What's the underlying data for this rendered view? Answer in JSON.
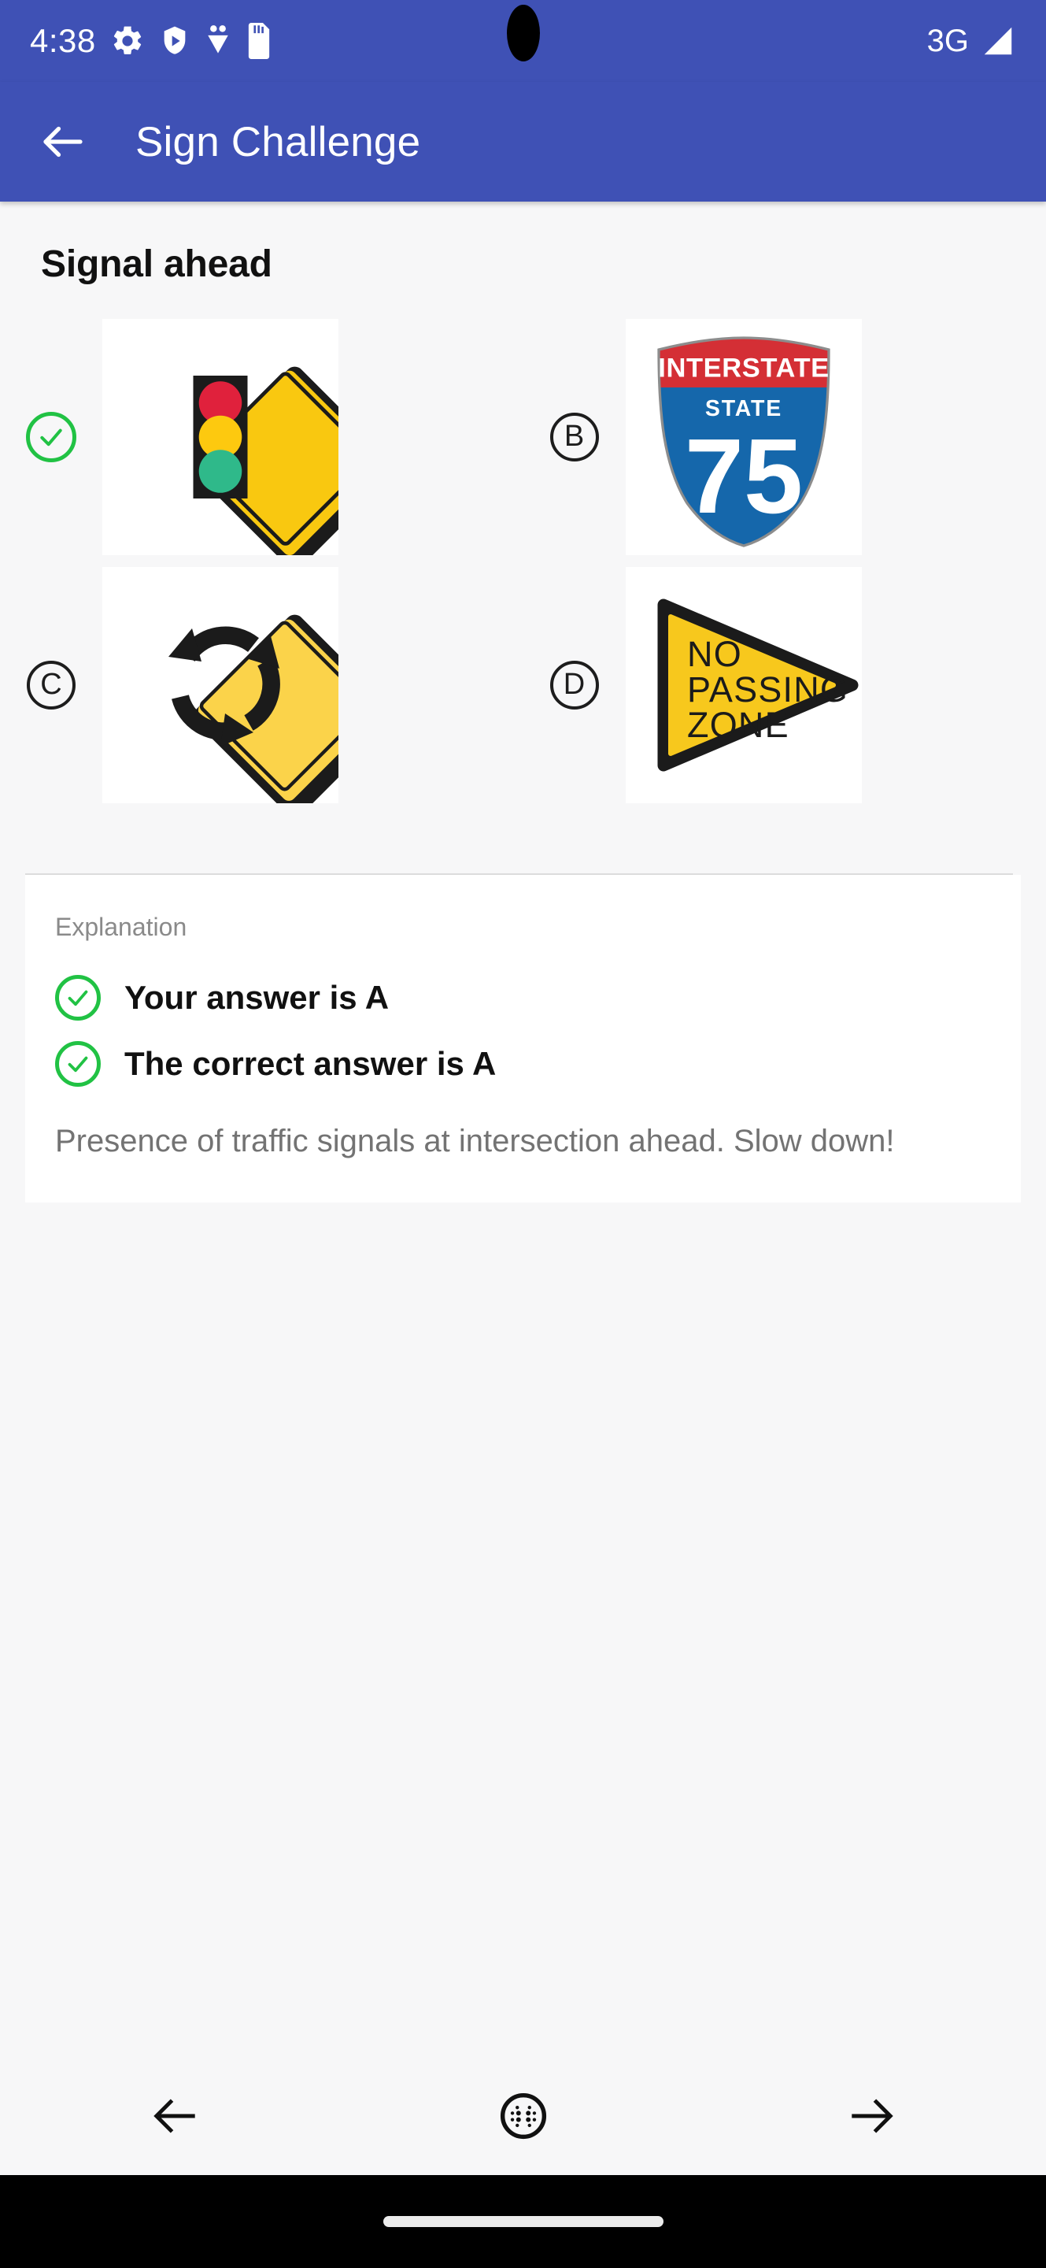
{
  "status_bar": {
    "time": "4:38",
    "icons": [
      "gear-icon",
      "shield-play-icon",
      "heart-pulse-icon",
      "sd-card-icon"
    ],
    "network": "3G",
    "signal_icon": "signal-triangle-icon"
  },
  "app_bar": {
    "back_icon": "back-arrow-icon",
    "title": "Sign Challenge",
    "background_color": "#3f51b5"
  },
  "quiz": {
    "question": "Signal ahead",
    "options": [
      {
        "letter": "A",
        "marker": "green-check-icon",
        "selected": true,
        "sign": {
          "name": "signal-ahead-sign",
          "shape": "diamond",
          "colors": {
            "face": "#f9c810",
            "border": "#1b1b1b",
            "red": "#e0213c",
            "yellow": "#fdc90f",
            "green": "#2fb98a"
          }
        }
      },
      {
        "letter": "B",
        "marker": "letter-circle",
        "selected": false,
        "sign": {
          "name": "interstate-75-shield",
          "shape": "shield",
          "text_top": "INTERSTATE",
          "text_mid": "STATE",
          "number": "75",
          "colors": {
            "red": "#d42f35",
            "blue": "#1567ab",
            "text": "#ffffff"
          }
        }
      },
      {
        "letter": "C",
        "marker": "letter-circle",
        "selected": false,
        "sign": {
          "name": "roundabout-ahead-sign",
          "shape": "diamond",
          "colors": {
            "face": "#fbd34a",
            "border": "#1b1b1b",
            "arrows": "#1b1b1b"
          }
        }
      },
      {
        "letter": "D",
        "marker": "letter-circle",
        "selected": false,
        "sign": {
          "name": "no-passing-zone-sign",
          "shape": "pennant",
          "lines": [
            "NO",
            "PASSING",
            "ZONE"
          ],
          "colors": {
            "face": "#f7c81d",
            "border": "#1b1b1b",
            "text": "#1b1b1b"
          }
        }
      }
    ]
  },
  "explanation": {
    "label": "Explanation",
    "your_answer": "Your answer is A",
    "correct_answer": "The correct answer is A",
    "body": "Presence of traffic signals at intersection ahead. Slow down!",
    "check_color": "#21c244"
  },
  "bottom_nav": {
    "prev_icon": "arrow-left-icon",
    "apps_icon": "dots-circle-icon",
    "next_icon": "arrow-right-icon"
  }
}
